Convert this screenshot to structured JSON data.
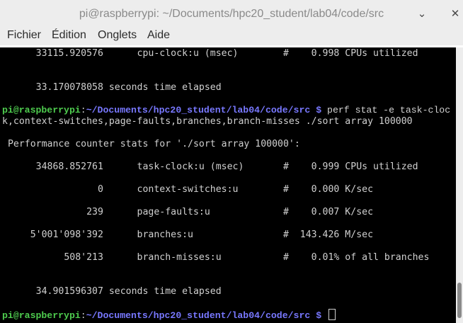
{
  "window": {
    "title": "pi@raspberrypi: ~/Documents/hpc20_student/lab04/code/src",
    "minimize": "⌄",
    "close": "✕"
  },
  "menu": [
    "Fichier",
    "Édition",
    "Onglets",
    "Aide"
  ],
  "terminal": {
    "line_cpu_prev": "      33115.920576      cpu-clock:u (msec)        #    0.998 CPUs utilized",
    "line_elapsed_prev": "      33.170078058 seconds time elapsed",
    "prompt1": {
      "user": "pi@raspberrypi",
      "sep": ":",
      "path": "~/Documents/hpc20_student/lab04/code/src",
      "symbol": " $ ",
      "command_a": "perf stat -e task-cloc",
      "command_b": "k,context-switches,page-faults,branches,branch-misses ./sort array 100000"
    },
    "header": " Performance counter stats for './sort array 100000':",
    "stats": [
      "      34868.852761      task-clock:u (msec)       #    0.999 CPUs utilized",
      "                 0      context-switches:u        #    0.000 K/sec",
      "               239      page-faults:u             #    0.007 K/sec",
      "     5'001'098'392      branches:u                #  143.426 M/sec",
      "           508'213      branch-misses:u           #    0.01% of all branches"
    ],
    "elapsed": "      34.901596307 seconds time elapsed",
    "prompt2": {
      "user": "pi@raspberrypi",
      "sep": ":",
      "path": "~/Documents/hpc20_student/lab04/code/src",
      "symbol": " $ "
    }
  },
  "colors": {
    "background": "#000000",
    "text": "#d0d0d0",
    "user": "#4ecb4e",
    "path": "#7878ff"
  }
}
